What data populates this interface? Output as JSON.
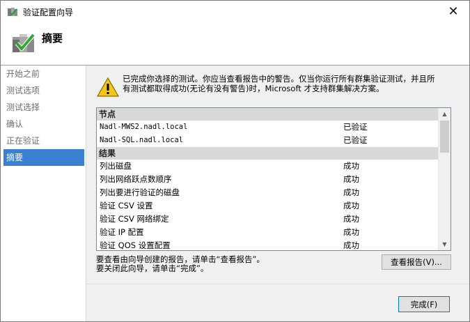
{
  "window": {
    "title": "验证配置向导",
    "close_glyph": "✕"
  },
  "header": {
    "title": "摘要",
    "icon": "wizard-check-icon"
  },
  "sidebar": {
    "items": [
      {
        "label": "开始之前",
        "active": false
      },
      {
        "label": "测试选项",
        "active": false
      },
      {
        "label": "测试选择",
        "active": false
      },
      {
        "label": "确认",
        "active": false
      },
      {
        "label": "正在验证",
        "active": false
      },
      {
        "label": "摘要",
        "active": true
      }
    ]
  },
  "main": {
    "warning_icon": "warning-icon",
    "message_line1": "已完成你选择的测试。你应当查看报告中的警告。仅当你运行所有群集验证测试，并且所",
    "message_line2": "有测试都取得成功(无论有没有警告)时，Microsoft 才支持群集解决方案。",
    "groups": [
      {
        "name": "节点",
        "rows": [
          {
            "name": "Nadl-MWS2.nadl.local",
            "status": "已验证"
          },
          {
            "name": "Nadl-SQL.nadl.local",
            "status": "已验证"
          }
        ]
      },
      {
        "name": "结果",
        "rows": [
          {
            "name": "列出磁盘",
            "status": "成功"
          },
          {
            "name": "列出网络跃点数顺序",
            "status": "成功"
          },
          {
            "name": "列出要进行验证的磁盘",
            "status": "成功"
          },
          {
            "name": "验证 CSV 设置",
            "status": "成功"
          },
          {
            "name": "验证 CSV 网络绑定",
            "status": "成功"
          },
          {
            "name": "验证 IP 配置",
            "status": "成功"
          },
          {
            "name": "验证 QOS 设置配置",
            "status": "成功"
          }
        ]
      }
    ],
    "footer_line1": "要查看由向导创建的报告，请单击“查看报告”。",
    "footer_line2": "要关闭此向导，请单击“完成”。",
    "view_report_label": "查看报告(V)...",
    "finish_label": "完成(F)"
  },
  "colors": {
    "accent": "#3a7fd1",
    "group_bg": "#d9d9d9",
    "warning": "#f5c518"
  }
}
